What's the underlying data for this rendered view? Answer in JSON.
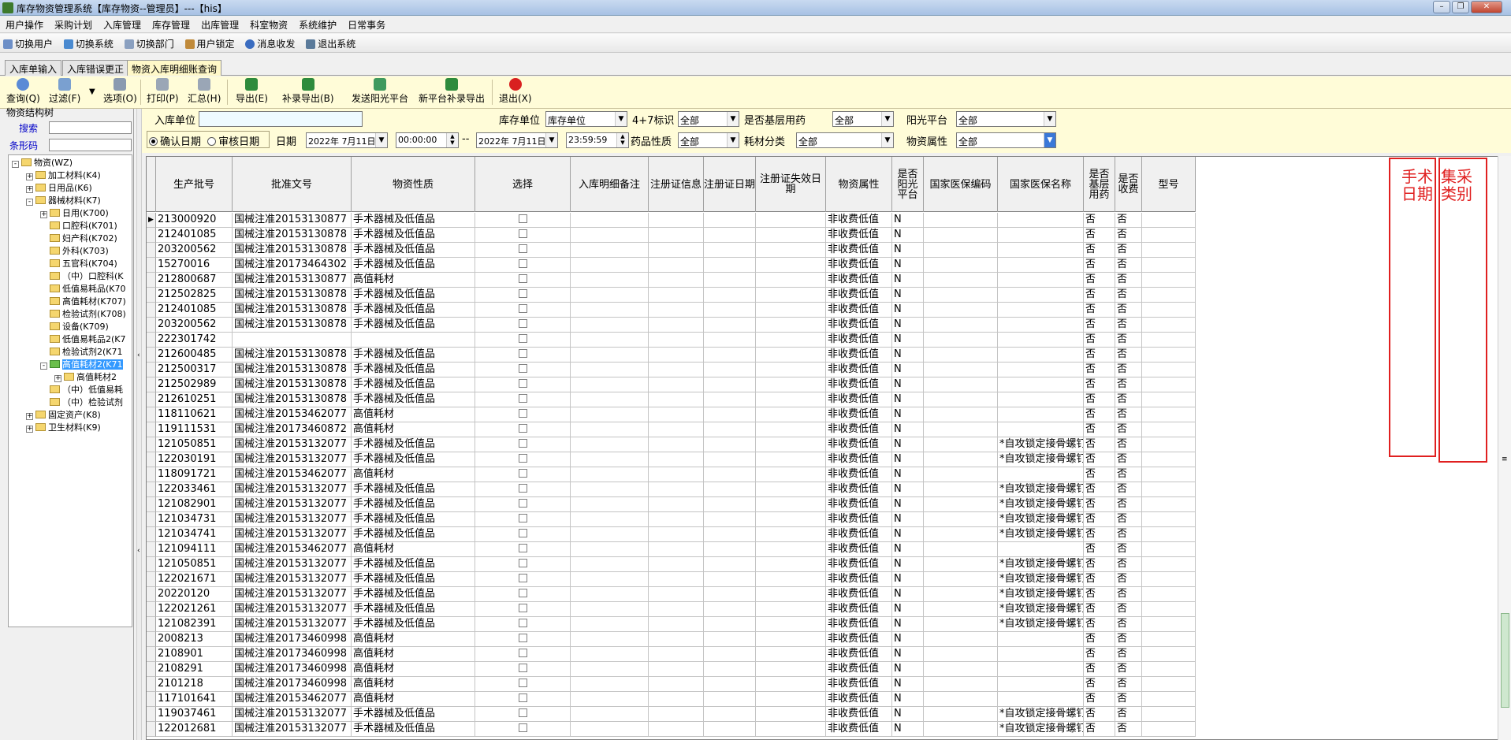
{
  "window": {
    "title": "库存物资管理系统【库存物资--管理员】---【his】"
  },
  "menu": [
    "用户操作",
    "采购计划",
    "入库管理",
    "库存管理",
    "出库管理",
    "科室物资",
    "系统维护",
    "日常事务"
  ],
  "quickbar": [
    "切换用户",
    "切换系统",
    "切换部门",
    "用户锁定",
    "消息收发",
    "退出系统"
  ],
  "tabs": [
    "入库单输入",
    "入库错误更正",
    "物资入库明细账查询"
  ],
  "toolbar": {
    "query": "查询(Q)",
    "filter": "过滤(F)",
    "options": "选项(O)",
    "print": "打印(P)",
    "summary": "汇总(H)",
    "export": "导出(E)",
    "supplement_export": "补录导出(B)",
    "send_sunshine": "发送阳光平台",
    "new_platform_export": "新平台补录导出",
    "exit": "退出(X)"
  },
  "left": {
    "title": "物资结构树",
    "search_label": "搜索",
    "barcode_label": "条形码",
    "tree": [
      {
        "label": "物资(WZ)",
        "level": 0,
        "exp": "-"
      },
      {
        "label": "加工材料(K4)",
        "level": 1,
        "exp": "+"
      },
      {
        "label": "日用品(K6)",
        "level": 1,
        "exp": "+"
      },
      {
        "label": "器械材料(K7)",
        "level": 1,
        "exp": "-"
      },
      {
        "label": "日用(K700)",
        "level": 2,
        "exp": "+"
      },
      {
        "label": "口腔科(K701)",
        "level": 2,
        "exp": ""
      },
      {
        "label": "妇产科(K702)",
        "level": 2,
        "exp": ""
      },
      {
        "label": "外科(K703)",
        "level": 2,
        "exp": ""
      },
      {
        "label": "五官科(K704)",
        "level": 2,
        "exp": ""
      },
      {
        "label": "（中）口腔科(K",
        "level": 2,
        "exp": ""
      },
      {
        "label": "低值易耗品(K70",
        "level": 2,
        "exp": ""
      },
      {
        "label": "高值耗材(K707)",
        "level": 2,
        "exp": ""
      },
      {
        "label": "检验试剂(K708)",
        "level": 2,
        "exp": ""
      },
      {
        "label": "设备(K709)",
        "level": 2,
        "exp": ""
      },
      {
        "label": "低值易耗品2(K7",
        "level": 2,
        "exp": ""
      },
      {
        "label": "检验试剂2(K71",
        "level": 2,
        "exp": ""
      },
      {
        "label": "高值耗材2(K71",
        "level": 2,
        "exp": "-",
        "selected": true
      },
      {
        "label": "高值耗材2",
        "level": 3,
        "exp": "+"
      },
      {
        "label": "（中）低值易耗",
        "level": 2,
        "exp": ""
      },
      {
        "label": "（中）检验试剂",
        "level": 2,
        "exp": ""
      },
      {
        "label": "固定资产(K8)",
        "level": 1,
        "exp": "+"
      },
      {
        "label": "卫生材料(K9)",
        "level": 1,
        "exp": "+"
      }
    ]
  },
  "filter": {
    "inbound_unit_label": "入库单位",
    "stock_unit_label": "库存单位",
    "stock_unit_value": "库存单位",
    "tag47_label": "4+7标识",
    "tag47_value": "全部",
    "basic_drug_label": "是否基层用药",
    "basic_drug_value": "全部",
    "sunshine_label": "阳光平台",
    "sunshine_value": "全部",
    "confirm_date_label": "确认日期",
    "audit_date_label": "审核日期",
    "date_label": "日期",
    "date_from": "2022年 7月11日",
    "time_from": "00:00:00",
    "range_sep": "--",
    "date_to": "2022年 7月11日",
    "time_to": "23:59:59",
    "drug_nature_label": "药品性质",
    "drug_nature_value": "全部",
    "consumable_label": "耗材分类",
    "consumable_value": "全部",
    "material_attr_label": "物资属性",
    "material_attr_value": "全部"
  },
  "grid": {
    "columns": [
      "生产批号",
      "批准文号",
      "物资性质",
      "选择",
      "入库明细备注",
      "注册证信息",
      "注册证日期",
      "注册证失效日期",
      "物资属性",
      "是否阳光平台",
      "国家医保编码",
      "国家医保名称",
      "是否基层用药",
      "是否收费",
      "型号"
    ],
    "rows": [
      [
        "213000920",
        "国械注准20153130877",
        "手术器械及低值品",
        "",
        "",
        "",
        "",
        "",
        "非收费低值",
        "N",
        "",
        "",
        "否",
        "否",
        ""
      ],
      [
        "212401085",
        "国械注准20153130878",
        "手术器械及低值品",
        "",
        "",
        "",
        "",
        "",
        "非收费低值",
        "N",
        "",
        "",
        "否",
        "否",
        ""
      ],
      [
        "203200562",
        "国械注准20153130878",
        "手术器械及低值品",
        "",
        "",
        "",
        "",
        "",
        "非收费低值",
        "N",
        "",
        "",
        "否",
        "否",
        ""
      ],
      [
        "15270016",
        "国械注准20173464302",
        "手术器械及低值品",
        "",
        "",
        "",
        "",
        "",
        "非收费低值",
        "N",
        "",
        "",
        "否",
        "否",
        ""
      ],
      [
        "212800687",
        "国械注准20153130877",
        "高值耗材",
        "",
        "",
        "",
        "",
        "",
        "非收费低值",
        "N",
        "",
        "",
        "否",
        "否",
        ""
      ],
      [
        "212502825",
        "国械注准20153130878",
        "手术器械及低值品",
        "",
        "",
        "",
        "",
        "",
        "非收费低值",
        "N",
        "",
        "",
        "否",
        "否",
        ""
      ],
      [
        "212401085",
        "国械注准20153130878",
        "手术器械及低值品",
        "",
        "",
        "",
        "",
        "",
        "非收费低值",
        "N",
        "",
        "",
        "否",
        "否",
        ""
      ],
      [
        "203200562",
        "国械注准20153130878",
        "手术器械及低值品",
        "",
        "",
        "",
        "",
        "",
        "非收费低值",
        "N",
        "",
        "",
        "否",
        "否",
        ""
      ],
      [
        "222301742",
        "",
        "",
        "",
        "",
        "",
        "",
        "",
        "非收费低值",
        "N",
        "",
        "",
        "否",
        "否",
        ""
      ],
      [
        "212600485",
        "国械注准20153130878",
        "手术器械及低值品",
        "",
        "",
        "",
        "",
        "",
        "非收费低值",
        "N",
        "",
        "",
        "否",
        "否",
        ""
      ],
      [
        "212500317",
        "国械注准20153130878",
        "手术器械及低值品",
        "",
        "",
        "",
        "",
        "",
        "非收费低值",
        "N",
        "",
        "",
        "否",
        "否",
        ""
      ],
      [
        "212502989",
        "国械注准20153130878",
        "手术器械及低值品",
        "",
        "",
        "",
        "",
        "",
        "非收费低值",
        "N",
        "",
        "",
        "否",
        "否",
        ""
      ],
      [
        "212610251",
        "国械注准20153130878",
        "手术器械及低值品",
        "",
        "",
        "",
        "",
        "",
        "非收费低值",
        "N",
        "",
        "",
        "否",
        "否",
        ""
      ],
      [
        "118110621",
        "国械注准20153462077",
        "高值耗材",
        "",
        "",
        "",
        "",
        "",
        "非收费低值",
        "N",
        "",
        "",
        "否",
        "否",
        ""
      ],
      [
        "119111531",
        "国械注准20173460872",
        "高值耗材",
        "",
        "",
        "",
        "",
        "",
        "非收费低值",
        "N",
        "",
        "",
        "否",
        "否",
        ""
      ],
      [
        "121050851",
        "国械注准20153132077",
        "手术器械及低值品",
        "",
        "",
        "",
        "",
        "",
        "非收费低值",
        "N",
        "",
        "*自攻锁定接骨螺钉",
        "否",
        "否",
        ""
      ],
      [
        "122030191",
        "国械注准20153132077",
        "手术器械及低值品",
        "",
        "",
        "",
        "",
        "",
        "非收费低值",
        "N",
        "",
        "*自攻锁定接骨螺钉",
        "否",
        "否",
        ""
      ],
      [
        "118091721",
        "国械注准20153462077",
        "高值耗材",
        "",
        "",
        "",
        "",
        "",
        "非收费低值",
        "N",
        "",
        "",
        "否",
        "否",
        ""
      ],
      [
        "122033461",
        "国械注准20153132077",
        "手术器械及低值品",
        "",
        "",
        "",
        "",
        "",
        "非收费低值",
        "N",
        "",
        "*自攻锁定接骨螺钉",
        "否",
        "否",
        ""
      ],
      [
        "121082901",
        "国械注准20153132077",
        "手术器械及低值品",
        "",
        "",
        "",
        "",
        "",
        "非收费低值",
        "N",
        "",
        "*自攻锁定接骨螺钉",
        "否",
        "否",
        ""
      ],
      [
        "121034731",
        "国械注准20153132077",
        "手术器械及低值品",
        "",
        "",
        "",
        "",
        "",
        "非收费低值",
        "N",
        "",
        "*自攻锁定接骨螺钉",
        "否",
        "否",
        ""
      ],
      [
        "121034741",
        "国械注准20153132077",
        "手术器械及低值品",
        "",
        "",
        "",
        "",
        "",
        "非收费低值",
        "N",
        "",
        "*自攻锁定接骨螺钉",
        "否",
        "否",
        ""
      ],
      [
        "121094111",
        "国械注准20153462077",
        "高值耗材",
        "",
        "",
        "",
        "",
        "",
        "非收费低值",
        "N",
        "",
        "",
        "否",
        "否",
        ""
      ],
      [
        "121050851",
        "国械注准20153132077",
        "手术器械及低值品",
        "",
        "",
        "",
        "",
        "",
        "非收费低值",
        "N",
        "",
        "*自攻锁定接骨螺钉",
        "否",
        "否",
        ""
      ],
      [
        "122021671",
        "国械注准20153132077",
        "手术器械及低值品",
        "",
        "",
        "",
        "",
        "",
        "非收费低值",
        "N",
        "",
        "*自攻锁定接骨螺钉",
        "否",
        "否",
        ""
      ],
      [
        "20220120",
        "国械注准20153132077",
        "手术器械及低值品",
        "",
        "",
        "",
        "",
        "",
        "非收费低值",
        "N",
        "",
        "*自攻锁定接骨螺钉",
        "否",
        "否",
        ""
      ],
      [
        "122021261",
        "国械注准20153132077",
        "手术器械及低值品",
        "",
        "",
        "",
        "",
        "",
        "非收费低值",
        "N",
        "",
        "*自攻锁定接骨螺钉",
        "否",
        "否",
        ""
      ],
      [
        "121082391",
        "国械注准20153132077",
        "手术器械及低值品",
        "",
        "",
        "",
        "",
        "",
        "非收费低值",
        "N",
        "",
        "*自攻锁定接骨螺钉",
        "否",
        "否",
        ""
      ],
      [
        "2008213",
        "国械注准20173460998",
        "高值耗材",
        "",
        "",
        "",
        "",
        "",
        "非收费低值",
        "N",
        "",
        "",
        "否",
        "否",
        ""
      ],
      [
        "2108901",
        "国械注准20173460998",
        "高值耗材",
        "",
        "",
        "",
        "",
        "",
        "非收费低值",
        "N",
        "",
        "",
        "否",
        "否",
        ""
      ],
      [
        "2108291",
        "国械注准20173460998",
        "高值耗材",
        "",
        "",
        "",
        "",
        "",
        "非收费低值",
        "N",
        "",
        "",
        "否",
        "否",
        ""
      ],
      [
        "2101218",
        "国械注准20173460998",
        "高值耗材",
        "",
        "",
        "",
        "",
        "",
        "非收费低值",
        "N",
        "",
        "",
        "否",
        "否",
        ""
      ],
      [
        "117101641",
        "国械注准20153462077",
        "高值耗材",
        "",
        "",
        "",
        "",
        "",
        "非收费低值",
        "N",
        "",
        "",
        "否",
        "否",
        ""
      ],
      [
        "119037461",
        "国械注准20153132077",
        "手术器械及低值品",
        "",
        "",
        "",
        "",
        "",
        "非收费低值",
        "N",
        "",
        "*自攻锁定接骨螺钉",
        "否",
        "否",
        ""
      ],
      [
        "122012681",
        "国械注准20153132077",
        "手术器械及低值品",
        "",
        "",
        "",
        "",
        "",
        "非收费低值",
        "N",
        "",
        "*自攻锁定接骨螺钉",
        "否",
        "否",
        ""
      ]
    ]
  },
  "annotations": {
    "surgery_date": "手术日期",
    "procurement_type": "集采类别"
  },
  "colors": {
    "toolbar_bg": "#fffcd8",
    "annotation_red": "#e02020",
    "tree_selected": "#3399ff"
  }
}
